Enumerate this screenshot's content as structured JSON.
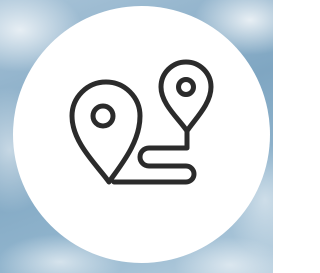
{
  "badge": {
    "background_color": "#ffffff",
    "icon": "route-map-pins-icon",
    "icon_color": "#2b2b2b"
  },
  "background": {
    "description_icon": "sky-clouds"
  }
}
